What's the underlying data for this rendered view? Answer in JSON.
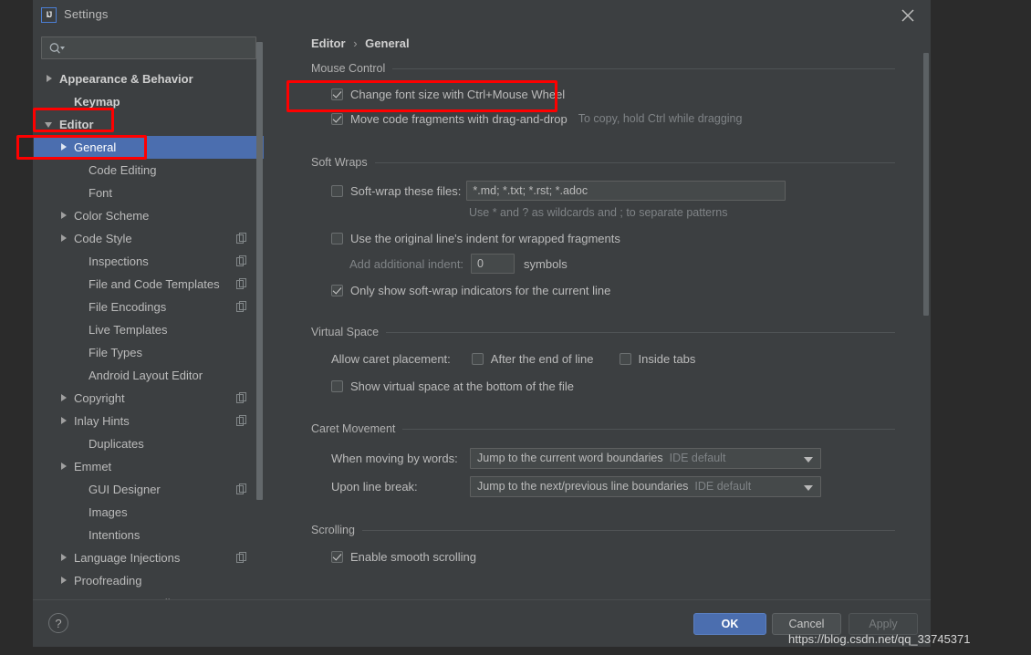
{
  "window": {
    "title": "Settings",
    "app_icon_text": "IJ",
    "close_icon": "close-icon"
  },
  "search": {
    "value": "",
    "placeholder": "",
    "icon": "search-icon"
  },
  "sidebar": {
    "items": [
      {
        "label": "Appearance & Behavior",
        "indent": 0,
        "twisty": "collapsed",
        "bold": true,
        "selected": false,
        "badge": false
      },
      {
        "label": "Keymap",
        "indent": 1,
        "twisty": "none",
        "bold": true,
        "selected": false,
        "badge": false
      },
      {
        "label": "Editor",
        "indent": 0,
        "twisty": "expanded",
        "bold": true,
        "selected": false,
        "badge": false
      },
      {
        "label": "General",
        "indent": 1,
        "twisty": "collapsed",
        "bold": false,
        "selected": true,
        "badge": false
      },
      {
        "label": "Code Editing",
        "indent": 2,
        "twisty": "none",
        "bold": false,
        "selected": false,
        "badge": false
      },
      {
        "label": "Font",
        "indent": 2,
        "twisty": "none",
        "bold": false,
        "selected": false,
        "badge": false
      },
      {
        "label": "Color Scheme",
        "indent": 1,
        "twisty": "collapsed",
        "bold": false,
        "selected": false,
        "badge": false
      },
      {
        "label": "Code Style",
        "indent": 1,
        "twisty": "collapsed",
        "bold": false,
        "selected": false,
        "badge": true
      },
      {
        "label": "Inspections",
        "indent": 2,
        "twisty": "none",
        "bold": false,
        "selected": false,
        "badge": true
      },
      {
        "label": "File and Code Templates",
        "indent": 2,
        "twisty": "none",
        "bold": false,
        "selected": false,
        "badge": true
      },
      {
        "label": "File Encodings",
        "indent": 2,
        "twisty": "none",
        "bold": false,
        "selected": false,
        "badge": true
      },
      {
        "label": "Live Templates",
        "indent": 2,
        "twisty": "none",
        "bold": false,
        "selected": false,
        "badge": false
      },
      {
        "label": "File Types",
        "indent": 2,
        "twisty": "none",
        "bold": false,
        "selected": false,
        "badge": false
      },
      {
        "label": "Android Layout Editor",
        "indent": 2,
        "twisty": "none",
        "bold": false,
        "selected": false,
        "badge": false
      },
      {
        "label": "Copyright",
        "indent": 1,
        "twisty": "collapsed",
        "bold": false,
        "selected": false,
        "badge": true
      },
      {
        "label": "Inlay Hints",
        "indent": 1,
        "twisty": "collapsed",
        "bold": false,
        "selected": false,
        "badge": true
      },
      {
        "label": "Duplicates",
        "indent": 2,
        "twisty": "none",
        "bold": false,
        "selected": false,
        "badge": false
      },
      {
        "label": "Emmet",
        "indent": 1,
        "twisty": "collapsed",
        "bold": false,
        "selected": false,
        "badge": false
      },
      {
        "label": "GUI Designer",
        "indent": 2,
        "twisty": "none",
        "bold": false,
        "selected": false,
        "badge": true
      },
      {
        "label": "Images",
        "indent": 2,
        "twisty": "none",
        "bold": false,
        "selected": false,
        "badge": false
      },
      {
        "label": "Intentions",
        "indent": 2,
        "twisty": "none",
        "bold": false,
        "selected": false,
        "badge": false
      },
      {
        "label": "Language Injections",
        "indent": 1,
        "twisty": "collapsed",
        "bold": false,
        "selected": false,
        "badge": true
      },
      {
        "label": "Proofreading",
        "indent": 1,
        "twisty": "collapsed",
        "bold": false,
        "selected": false,
        "badge": false
      },
      {
        "label": "TextMate Bundles",
        "indent": 2,
        "twisty": "none",
        "bold": false,
        "selected": false,
        "badge": false
      }
    ]
  },
  "breadcrumb": {
    "root": "Editor",
    "separator": "›",
    "leaf": "General"
  },
  "sections": {
    "mouse_control": {
      "title": "Mouse Control",
      "change_font_size": {
        "label": "Change font size with Ctrl+Mouse Wheel",
        "checked": true
      },
      "move_code_fragments": {
        "label": "Move code fragments with drag-and-drop",
        "checked": true
      },
      "move_code_hint": "To copy, hold Ctrl while dragging"
    },
    "soft_wraps": {
      "title": "Soft Wraps",
      "soft_wrap_files": {
        "label": "Soft-wrap these files:",
        "checked": false,
        "value": "*.md; *.txt; *.rst; *.adoc"
      },
      "wildcards_hint": "Use * and ? as wildcards and ; to separate patterns",
      "original_indent": {
        "label": "Use the original line's indent for wrapped fragments",
        "checked": false
      },
      "additional_indent": {
        "label": "Add additional indent:",
        "value": "0",
        "units": "symbols"
      },
      "only_show_indicators": {
        "label": "Only show soft-wrap indicators for the current line",
        "checked": true
      }
    },
    "virtual_space": {
      "title": "Virtual Space",
      "allow_caret_label": "Allow caret placement:",
      "after_end_of_line": {
        "label": "After the end of line",
        "checked": false
      },
      "inside_tabs": {
        "label": "Inside tabs",
        "checked": false
      },
      "show_virtual_space": {
        "label": "Show virtual space at the bottom of the file",
        "checked": false
      }
    },
    "caret_movement": {
      "title": "Caret Movement",
      "when_moving_label": "When moving by words:",
      "when_moving_value": "Jump to the current word boundaries",
      "when_moving_suffix": "IDE default",
      "upon_line_break_label": "Upon line break:",
      "upon_line_break_value": "Jump to the next/previous line boundaries",
      "upon_line_break_suffix": "IDE default"
    },
    "scrolling": {
      "title": "Scrolling",
      "enable_smooth": {
        "label": "Enable smooth scrolling",
        "checked": true
      }
    }
  },
  "buttons": {
    "help": "?",
    "ok": "OK",
    "cancel": "Cancel",
    "apply": "Apply"
  },
  "watermark": "https://blog.csdn.net/qq_33745371",
  "colors": {
    "dialog_bg": "#3c3f41",
    "page_bg": "#2b2b2b",
    "selection_blue": "#4b6eaf",
    "annotation_red": "#fe0000",
    "text": "#bbbbbb",
    "dim_text": "#7f8386"
  }
}
